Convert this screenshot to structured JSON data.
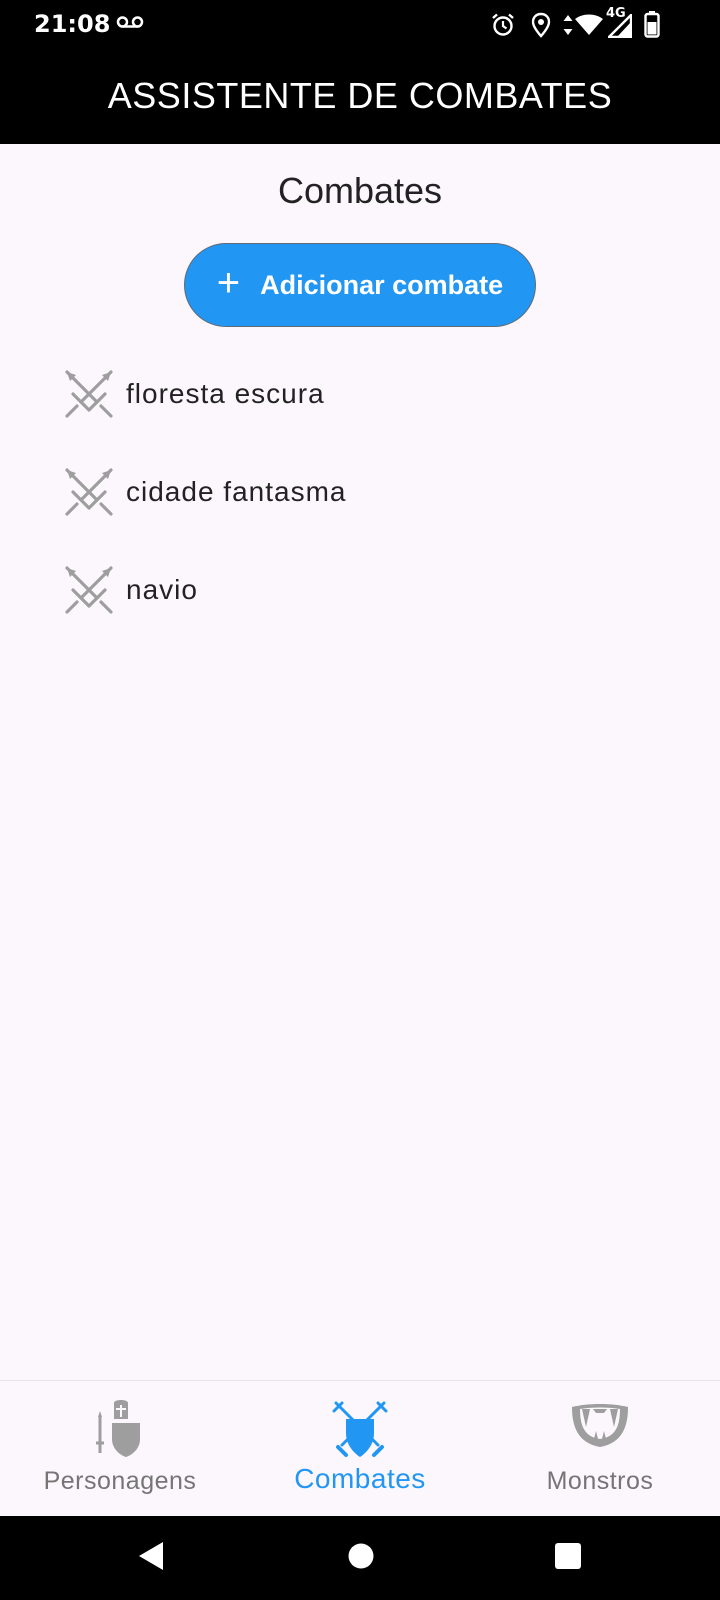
{
  "status_bar": {
    "time": "21:08",
    "network": "4G",
    "icons": [
      "voicemail-icon",
      "alarm-icon",
      "location-icon",
      "data-arrows-icon",
      "wifi-icon",
      "signal-icon",
      "battery-icon"
    ]
  },
  "app_bar": {
    "title": "ASSISTENTE DE COMBATES"
  },
  "screen": {
    "title": "Combates",
    "add_button": {
      "label": "Adicionar combate",
      "icon": "plus-icon"
    }
  },
  "combats": [
    {
      "label": "floresta escura",
      "icon": "crossed-swords-icon"
    },
    {
      "label": "cidade fantasma",
      "icon": "crossed-swords-icon"
    },
    {
      "label": "navio",
      "icon": "crossed-swords-icon"
    }
  ],
  "bottom_nav": {
    "items": [
      {
        "label": "Personagens",
        "icon": "knight-icon",
        "active": false
      },
      {
        "label": "Combates",
        "icon": "swords-shield-icon",
        "active": true
      },
      {
        "label": "Monstros",
        "icon": "fangs-icon",
        "active": false
      }
    ]
  },
  "colors": {
    "accent": "#2196f3",
    "background": "#fcf6fd",
    "app_bar": "#000000",
    "icon_inactive": "#9e9e9e"
  },
  "system_nav": {
    "buttons": [
      "back-icon",
      "home-icon",
      "recents-icon"
    ]
  }
}
